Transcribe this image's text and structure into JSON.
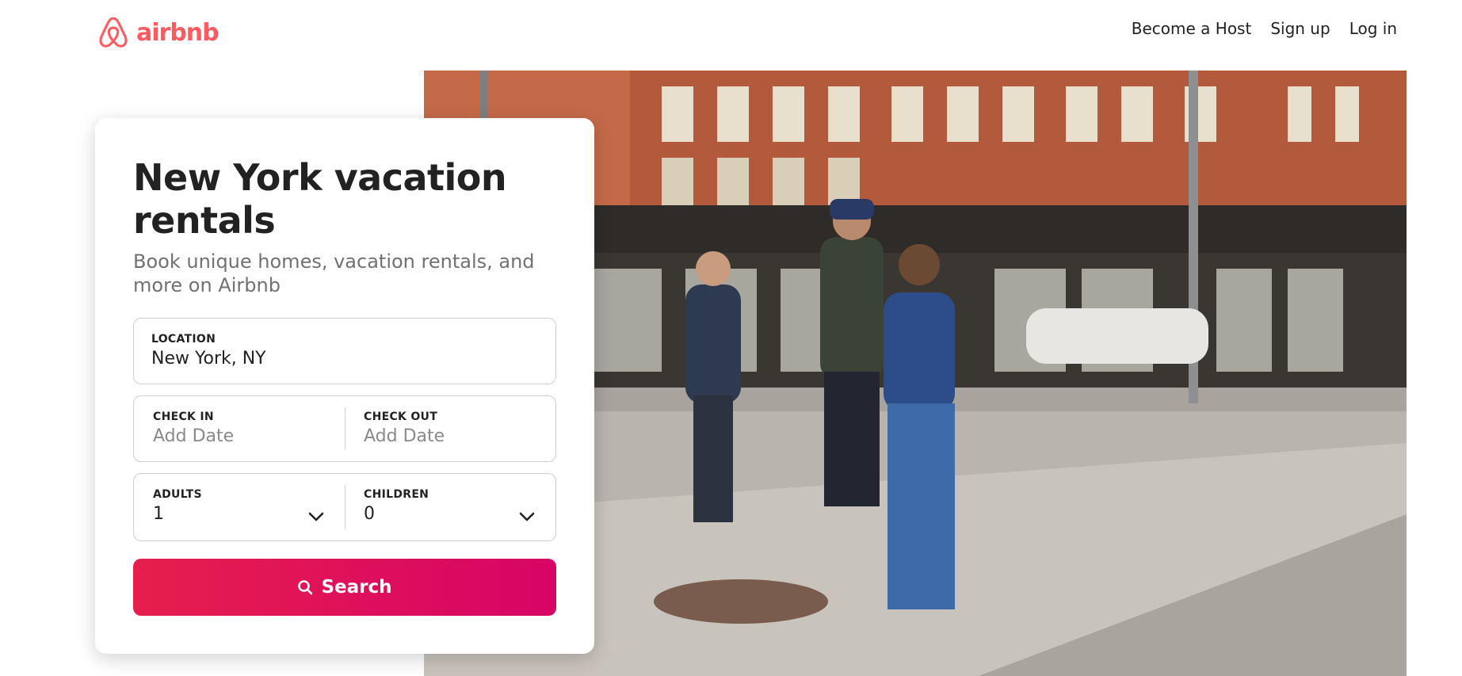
{
  "brand": {
    "name": "airbnb",
    "color": "#FF5A5F"
  },
  "nav": {
    "become_host": "Become a Host",
    "sign_up": "Sign up",
    "log_in": "Log in"
  },
  "card": {
    "title": "New York vacation rentals",
    "subtitle": "Book unique homes, vacation rentals, and more on Airbnb"
  },
  "location": {
    "label": "LOCATION",
    "value": "New York, NY"
  },
  "dates": {
    "check_in_label": "CHECK IN",
    "check_in_placeholder": "Add Date",
    "check_out_label": "CHECK OUT",
    "check_out_placeholder": "Add Date"
  },
  "guests": {
    "adults_label": "ADULTS",
    "adults_value": "1",
    "children_label": "CHILDREN",
    "children_value": "0"
  },
  "search_button": {
    "label": "Search",
    "icon": "search-icon",
    "gradient": [
      "#E61E4D",
      "#D70466"
    ]
  }
}
